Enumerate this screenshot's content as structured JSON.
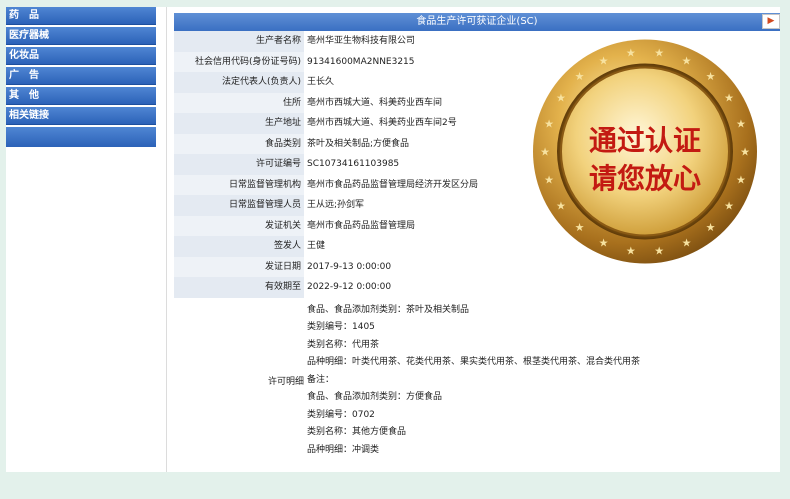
{
  "nav": {
    "items": [
      "药　品",
      "医疗器械",
      "化妆品",
      "广　告",
      "其　他",
      "相关链接"
    ]
  },
  "panel": {
    "title": "食品生产许可获证企业(SC)",
    "arrow": "▶"
  },
  "rows": [
    {
      "label": "生产者名称",
      "value": "亳州华亚生物科技有限公司"
    },
    {
      "label": "社会信用代码(身份证号码)",
      "value": "91341600MA2NNE3215"
    },
    {
      "label": "法定代表人(负责人)",
      "value": "王长久"
    },
    {
      "label": "住所",
      "value": "亳州市西城大道、科美药业西车间"
    },
    {
      "label": "生产地址",
      "value": "亳州市西城大道、科美药业西车间2号"
    },
    {
      "label": "食品类别",
      "value": "茶叶及相关制品;方便食品"
    },
    {
      "label": "许可证编号",
      "value": "SC10734161103985"
    },
    {
      "label": "日常监督管理机构",
      "value": "亳州市食品药品监督管理局经济开发区分局"
    },
    {
      "label": "日常监督管理人员",
      "value": "王从远;孙剑军"
    },
    {
      "label": "发证机关",
      "value": "亳州市食品药品监督管理局"
    },
    {
      "label": "签发人",
      "value": "王健"
    },
    {
      "label": "发证日期",
      "value": "2017-9-13 0:00:00"
    },
    {
      "label": "有效期至",
      "value": "2022-9-12 0:00:00"
    }
  ],
  "details": {
    "label": "许可明细",
    "lines": [
      "食品、食品添加剂类别：茶叶及相关制品",
      "类别编号：1405",
      "类别名称：代用茶",
      "品种明细：叶类代用茶、花类代用茶、果实类代用茶、根茎类代用茶、混合类代用茶",
      "备注：",
      "食品、食品添加剂类别：方便食品",
      "类别编号：0702",
      "类别名称：其他方便食品",
      "品种明细：冲调类"
    ]
  },
  "seal": {
    "line1": "通过认证",
    "line2": "请您放心"
  },
  "colors": {
    "nav": "#2c62b8",
    "seal_gold": "#c9962f",
    "seal_red": "#c31a12"
  }
}
